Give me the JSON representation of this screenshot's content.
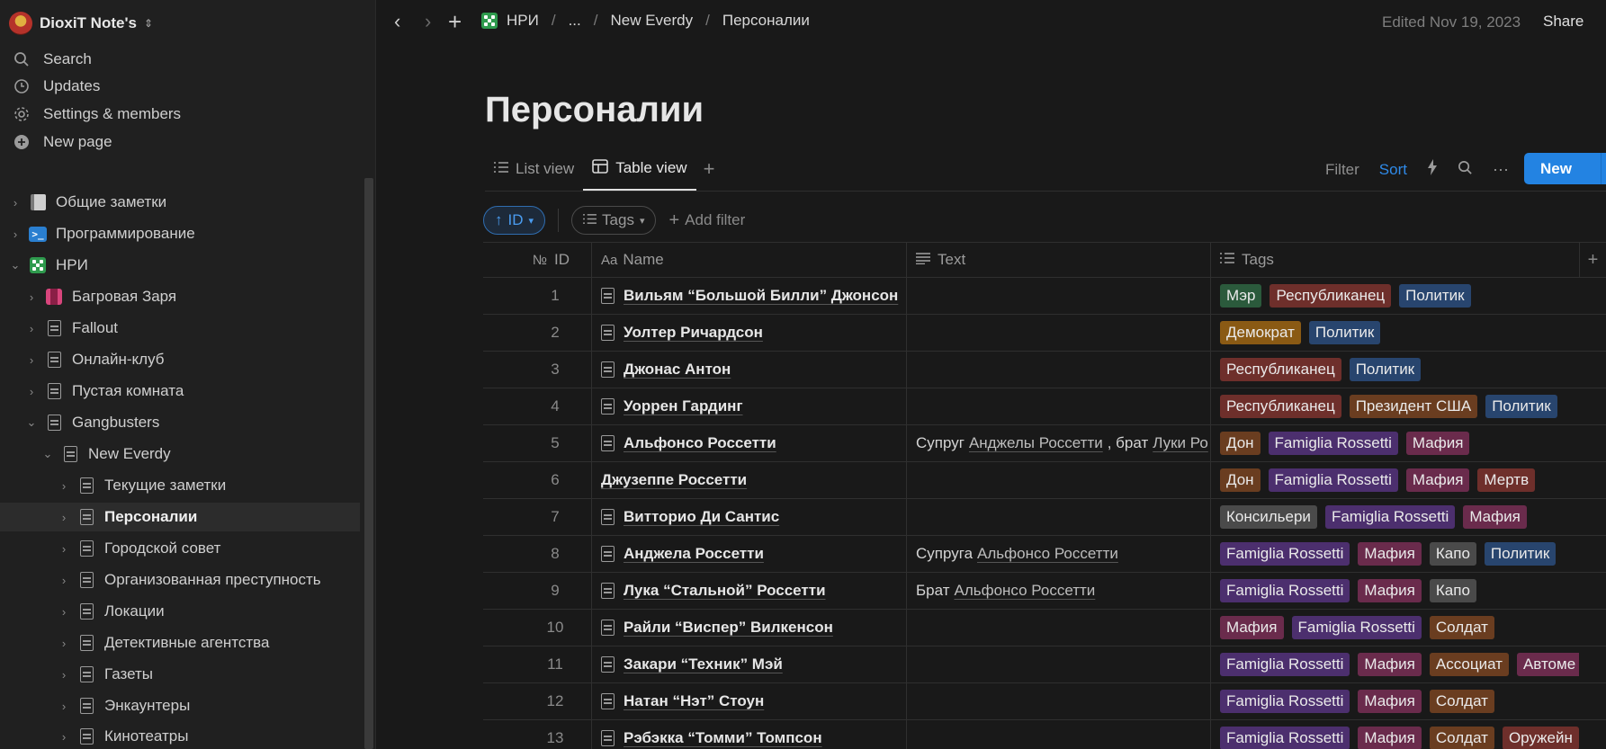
{
  "workspace": {
    "name": "DioxiT Note's",
    "caret": "⌃"
  },
  "sidebar": {
    "menu": [
      {
        "label": "Search",
        "icon": "search-icon"
      },
      {
        "label": "Updates",
        "icon": "clock-icon"
      },
      {
        "label": "Settings & members",
        "icon": "gear-icon"
      },
      {
        "label": "New page",
        "icon": "plus-circle-icon"
      }
    ],
    "tree": [
      {
        "label": "Общие заметки"
      },
      {
        "label": "Программирование",
        "icon_text": ">_"
      },
      {
        "label": "НРИ"
      },
      {
        "label": "Багровая Заря"
      },
      {
        "label": "Fallout"
      },
      {
        "label": "Онлайн-клуб"
      },
      {
        "label": "Пустая комната"
      },
      {
        "label": "Gangbusters"
      },
      {
        "label": "New Everdy"
      },
      {
        "label": "Текущие заметки"
      },
      {
        "label": "Персоналии"
      },
      {
        "label": "Городской совет"
      },
      {
        "label": "Организованная преступность"
      },
      {
        "label": "Локации"
      },
      {
        "label": "Детективные агентства"
      },
      {
        "label": "Газеты"
      },
      {
        "label": "Энкаунтеры"
      },
      {
        "label": "Кинотеатры"
      }
    ]
  },
  "topbar": {
    "breadcrumbs": [
      "НРИ",
      "...",
      "New Everdy",
      "Персоналии"
    ],
    "edited": "Edited Nov 19, 2023",
    "share": "Share"
  },
  "page": {
    "title": "Персоналии",
    "views": [
      {
        "label": "List view"
      },
      {
        "label": "Table view"
      }
    ],
    "toolbar": {
      "filter": "Filter",
      "sort": "Sort",
      "new": "New"
    },
    "filters": {
      "sort_chip": "ID",
      "tags_chip": "Tags",
      "add_filter": "Add filter"
    }
  },
  "table": {
    "columns": {
      "id_prefix": "№",
      "id": "ID",
      "name_prefix": "Aa",
      "name": "Name",
      "text": "Text",
      "tags": "Tags",
      "add": "+"
    },
    "rows": [
      {
        "id": "1",
        "name": "Вильям “Большой Билли” Джонсон",
        "text": [],
        "tags": [
          [
            "Мэр",
            "t-green"
          ],
          [
            "Республиканец",
            "t-red"
          ],
          [
            "Политик",
            "t-blue"
          ]
        ]
      },
      {
        "id": "2",
        "name": "Уолтер Ричардсон",
        "text": [],
        "tags": [
          [
            "Демократ",
            "t-orange"
          ],
          [
            "Политик",
            "t-blue"
          ]
        ]
      },
      {
        "id": "3",
        "name": "Джонас Антон",
        "text": [],
        "tags": [
          [
            "Республиканец",
            "t-red"
          ],
          [
            "Политик",
            "t-blue"
          ]
        ]
      },
      {
        "id": "4",
        "name": "Уоррен Гардинг",
        "text": [],
        "tags": [
          [
            "Республиканец",
            "t-red"
          ],
          [
            "Президент США",
            "t-brown"
          ],
          [
            "Политик",
            "t-blue"
          ]
        ]
      },
      {
        "id": "5",
        "name": "Альфонсо Россетти",
        "text": [
          [
            "Супруг",
            ""
          ],
          [
            "Анджелы Россетти",
            "lnk"
          ],
          [
            ", брат",
            ""
          ],
          [
            "Луки Ро",
            "lnk"
          ]
        ],
        "tags": [
          [
            "Дон",
            "t-brown"
          ],
          [
            "Famiglia Rossetti",
            "t-purple"
          ],
          [
            "Мафия",
            "t-pink"
          ]
        ]
      },
      {
        "id": "6",
        "name": "Джузеппе Россетти",
        "noicon": true,
        "text": [],
        "tags": [
          [
            "Дон",
            "t-brown"
          ],
          [
            "Famiglia Rossetti",
            "t-purple"
          ],
          [
            "Мафия",
            "t-pink"
          ],
          [
            "Мертв",
            "t-red"
          ]
        ]
      },
      {
        "id": "7",
        "name": "Витторио Ди Сантис",
        "text": [],
        "tags": [
          [
            "Консильери",
            "t-gray"
          ],
          [
            "Famiglia Rossetti",
            "t-purple"
          ],
          [
            "Мафия",
            "t-pink"
          ]
        ]
      },
      {
        "id": "8",
        "name": "Анджела Россетти",
        "text": [
          [
            "Супруга",
            ""
          ],
          [
            "Альфонсо Россетти",
            "lnk"
          ]
        ],
        "tags": [
          [
            "Famiglia Rossetti",
            "t-purple"
          ],
          [
            "Мафия",
            "t-pink"
          ],
          [
            "Капо",
            "t-gray"
          ],
          [
            "Политик",
            "t-blue"
          ]
        ]
      },
      {
        "id": "9",
        "name": "Лука “Стальной” Россетти",
        "text": [
          [
            "Брат",
            ""
          ],
          [
            "Альфонсо Россетти",
            "lnk"
          ]
        ],
        "tags": [
          [
            "Famiglia Rossetti",
            "t-purple"
          ],
          [
            "Мафия",
            "t-pink"
          ],
          [
            "Капо",
            "t-gray"
          ]
        ]
      },
      {
        "id": "10",
        "name": "Райли “Виспер” Вилкенсон",
        "text": [],
        "tags": [
          [
            "Мафия",
            "t-pink"
          ],
          [
            "Famiglia Rossetti",
            "t-purple"
          ],
          [
            "Солдат",
            "t-brown"
          ]
        ]
      },
      {
        "id": "11",
        "name": "Закари “Техник” Мэй",
        "text": [],
        "tags": [
          [
            "Famiglia Rossetti",
            "t-purple"
          ],
          [
            "Мафия",
            "t-pink"
          ],
          [
            "Ассоциат",
            "t-brown"
          ],
          [
            "Автоме",
            "t-pink"
          ]
        ]
      },
      {
        "id": "12",
        "name": "Натан “Нэт” Стоун",
        "text": [],
        "tags": [
          [
            "Famiglia Rossetti",
            "t-purple"
          ],
          [
            "Мафия",
            "t-pink"
          ],
          [
            "Солдат",
            "t-brown"
          ]
        ]
      },
      {
        "id": "13",
        "name": "Рэбэкка “Томми” Томпсон",
        "text": [],
        "tags": [
          [
            "Famiglia Rossetti",
            "t-purple"
          ],
          [
            "Мафия",
            "t-pink"
          ],
          [
            "Солдат",
            "t-brown"
          ],
          [
            "Оружейн",
            "t-red"
          ]
        ]
      }
    ]
  }
}
